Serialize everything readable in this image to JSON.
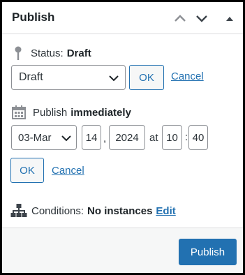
{
  "header": {
    "title": "Publish",
    "move_up_icon": "chevron-up-icon",
    "move_down_icon": "chevron-down-icon",
    "toggle_icon": "triangle-up-icon"
  },
  "status": {
    "icon": "pin-icon",
    "label": "Status:",
    "value": "Draft",
    "select_value": "Draft",
    "ok_label": "OK",
    "cancel_label": "Cancel"
  },
  "schedule": {
    "icon": "calendar-icon",
    "label": "Publish",
    "value": "immediately",
    "month": "03-Mar",
    "day": "14",
    "comma": ",",
    "year": "2024",
    "at": "at",
    "hour": "10",
    "colon": ":",
    "minute": "40",
    "ok_label": "OK",
    "cancel_label": "Cancel"
  },
  "conditions": {
    "icon": "sitemap-icon",
    "label": "Conditions:",
    "value": "No instances",
    "edit_label": "Edit"
  },
  "footer": {
    "publish_label": "Publish"
  },
  "colors": {
    "accent": "#2271b1",
    "footer_bg": "#f6f7f7",
    "border": "#8c8f94"
  }
}
